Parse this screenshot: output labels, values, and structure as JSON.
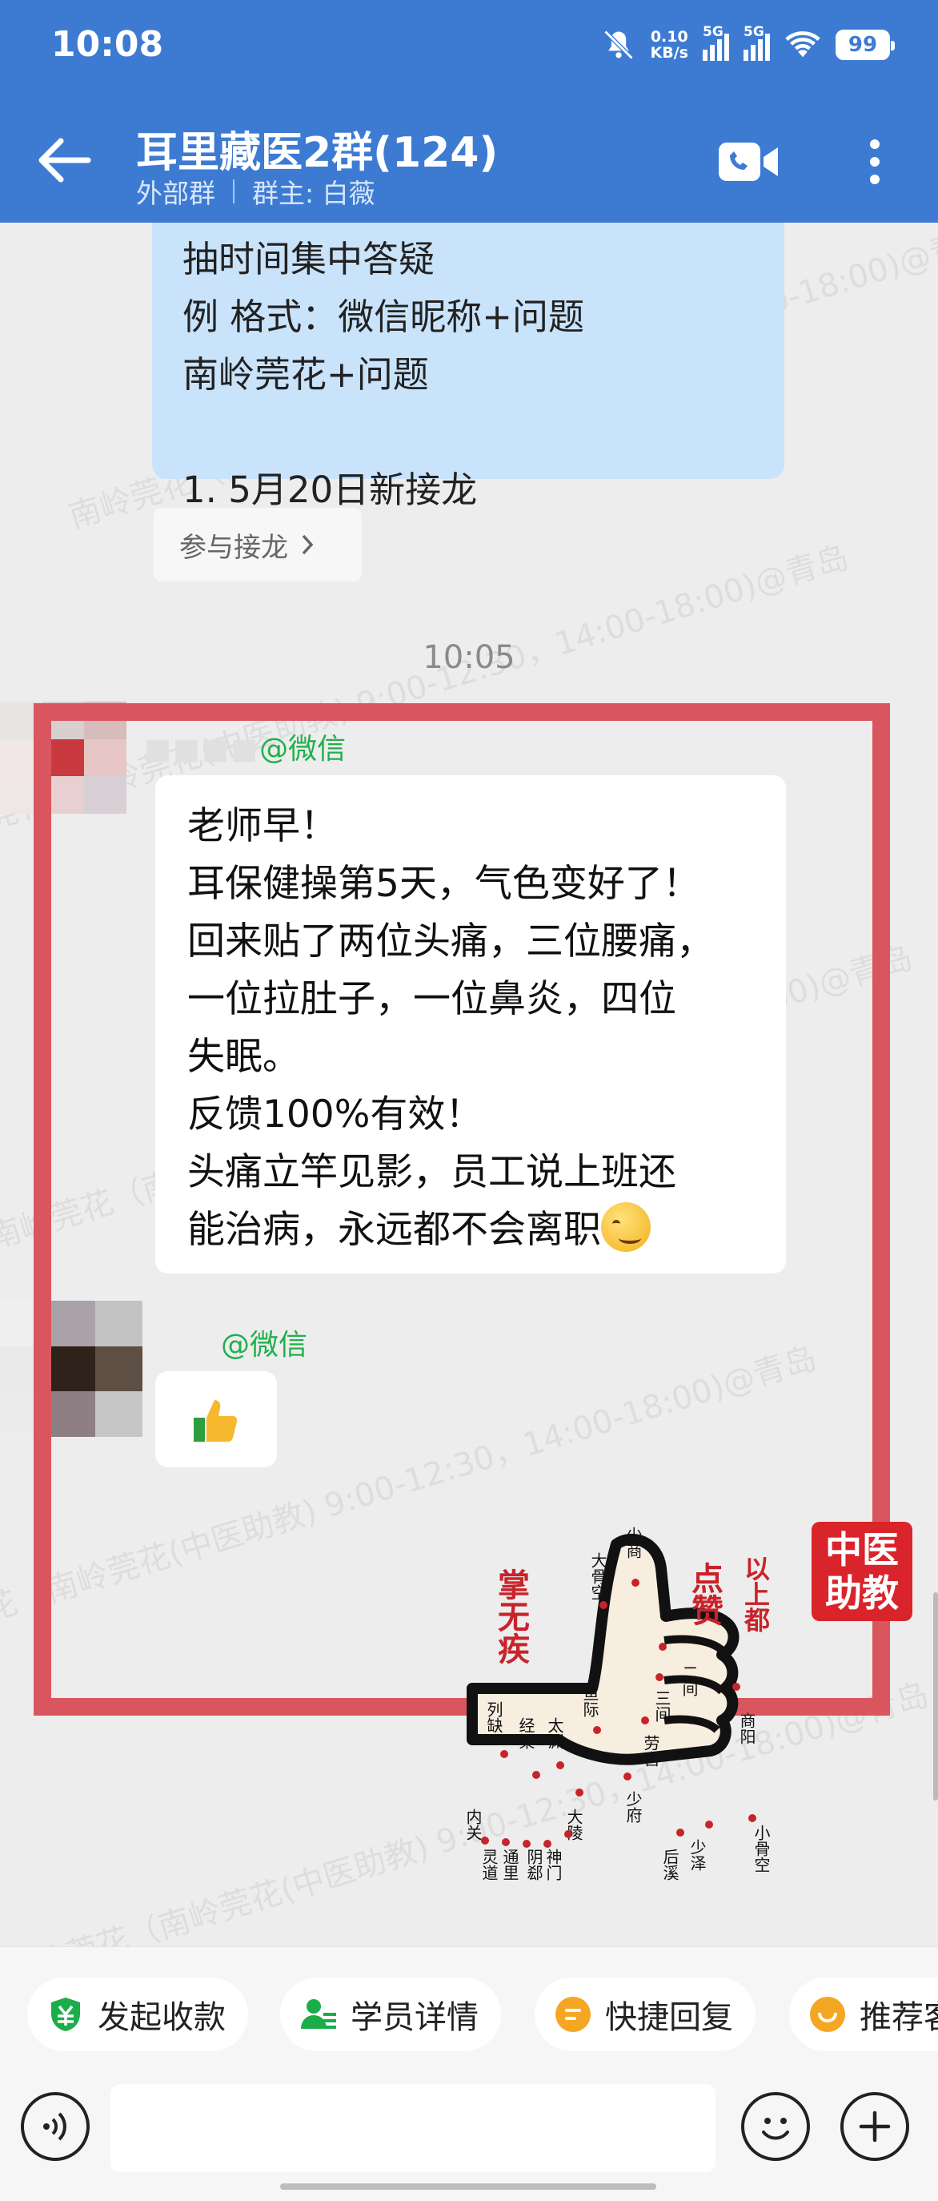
{
  "status_bar": {
    "time": "10:08",
    "net_speed_value": "0.10",
    "net_speed_unit": "KB/s",
    "signal1_label": "5G",
    "signal2_label": "5G",
    "battery": "99"
  },
  "header": {
    "title": "耳里藏医2群(124)",
    "group_type": "外部群",
    "owner": "群主: 白薇",
    "color": "#3d7bd3"
  },
  "messages": {
    "bubble_lines": [
      "抽时间集中答疑",
      "例 格式：微信昵称+问题",
      "南岭莞花+问题",
      "",
      "1. 5月20日新接龙"
    ],
    "join_button": "参与接龙",
    "timestamp": "10:05",
    "sender1_suffix": "@微信",
    "message_lines": [
      "老师早！",
      "耳保健操第5天，气色变好了！",
      "回来贴了两位头痛，三位腰痛，",
      "一位拉肚子，一位鼻炎，四位",
      "失眠。",
      "反馈100%有效！",
      "头痛立竿见影，员工说上班还",
      "能治病，永远都不会离职"
    ],
    "sender2_suffix": "@微信",
    "thumbs_emoji": "👍"
  },
  "sticker": {
    "logo_line1": "中医",
    "logo_line2": "助教",
    "slogan_left": "掌无疾",
    "slogan_right_big": "点赞",
    "slogan_right_small": "以上都",
    "points": {
      "shaoshang": "少商",
      "dagukong": "大骨空",
      "erjian": "二间",
      "sanjian": "三间",
      "yuji": "鱼际",
      "shangyang": "商阳",
      "laogong": "劳宫",
      "shaofu": "少府",
      "lieque": "列缺",
      "jingqu": "经渠",
      "taiyuan": "太渊",
      "daling": "大陵",
      "neiguan": "内关",
      "lingdao": "灵道",
      "tongli": "通里",
      "yinxi": "阴郄",
      "shenmen": "神门",
      "houxi": "后溪",
      "shaoze": "少泽",
      "xiaogukong": "小骨空"
    }
  },
  "watermark": "南岭莞花（南岭莞花(中医助教) 9:00-12:30，14:00-18:00)@青岛",
  "quick_actions": [
    {
      "label": "发起收款",
      "icon": "payment-icon"
    },
    {
      "label": "学员详情",
      "icon": "student-icon"
    },
    {
      "label": "快捷回复",
      "icon": "quick-reply-icon"
    },
    {
      "label": "推荐客户",
      "icon": "recommend-icon"
    }
  ]
}
